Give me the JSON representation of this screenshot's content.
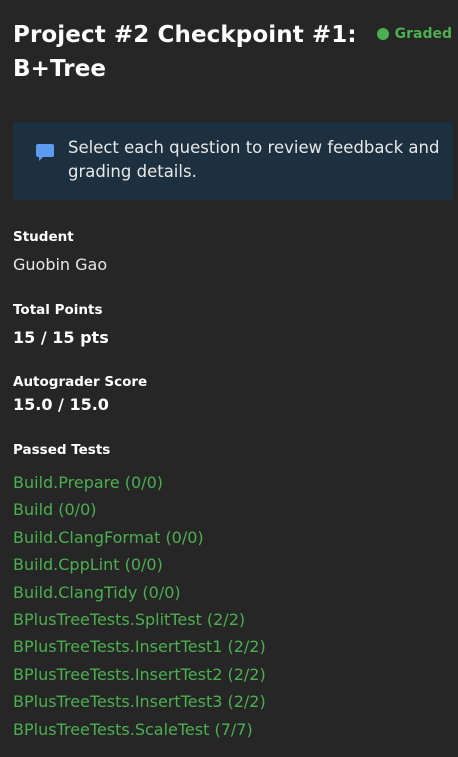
{
  "header": {
    "title": "Project #2 Checkpoint #1: B+Tree",
    "status": "Graded",
    "status_color": "#4caf50"
  },
  "info": {
    "icon": "comment-icon",
    "text": "Select each question to review feedback and grading details."
  },
  "student": {
    "label": "Student",
    "value": "Guobin Gao"
  },
  "total_points": {
    "label": "Total Points",
    "value": "15 / 15 pts"
  },
  "autograder": {
    "label": "Autograder Score",
    "value": "15.0 / 15.0"
  },
  "passed_tests": {
    "label": "Passed Tests",
    "items": [
      "Build.Prepare (0/0)",
      "Build (0/0)",
      "Build.ClangFormat (0/0)",
      "Build.CppLint (0/0)",
      "Build.ClangTidy (0/0)",
      "BPlusTreeTests.SplitTest (2/2)",
      "BPlusTreeTests.InsertTest1 (2/2)",
      "BPlusTreeTests.InsertTest2 (2/2)",
      "BPlusTreeTests.InsertTest3 (2/2)",
      "BPlusTreeTests.ScaleTest (7/7)"
    ]
  }
}
